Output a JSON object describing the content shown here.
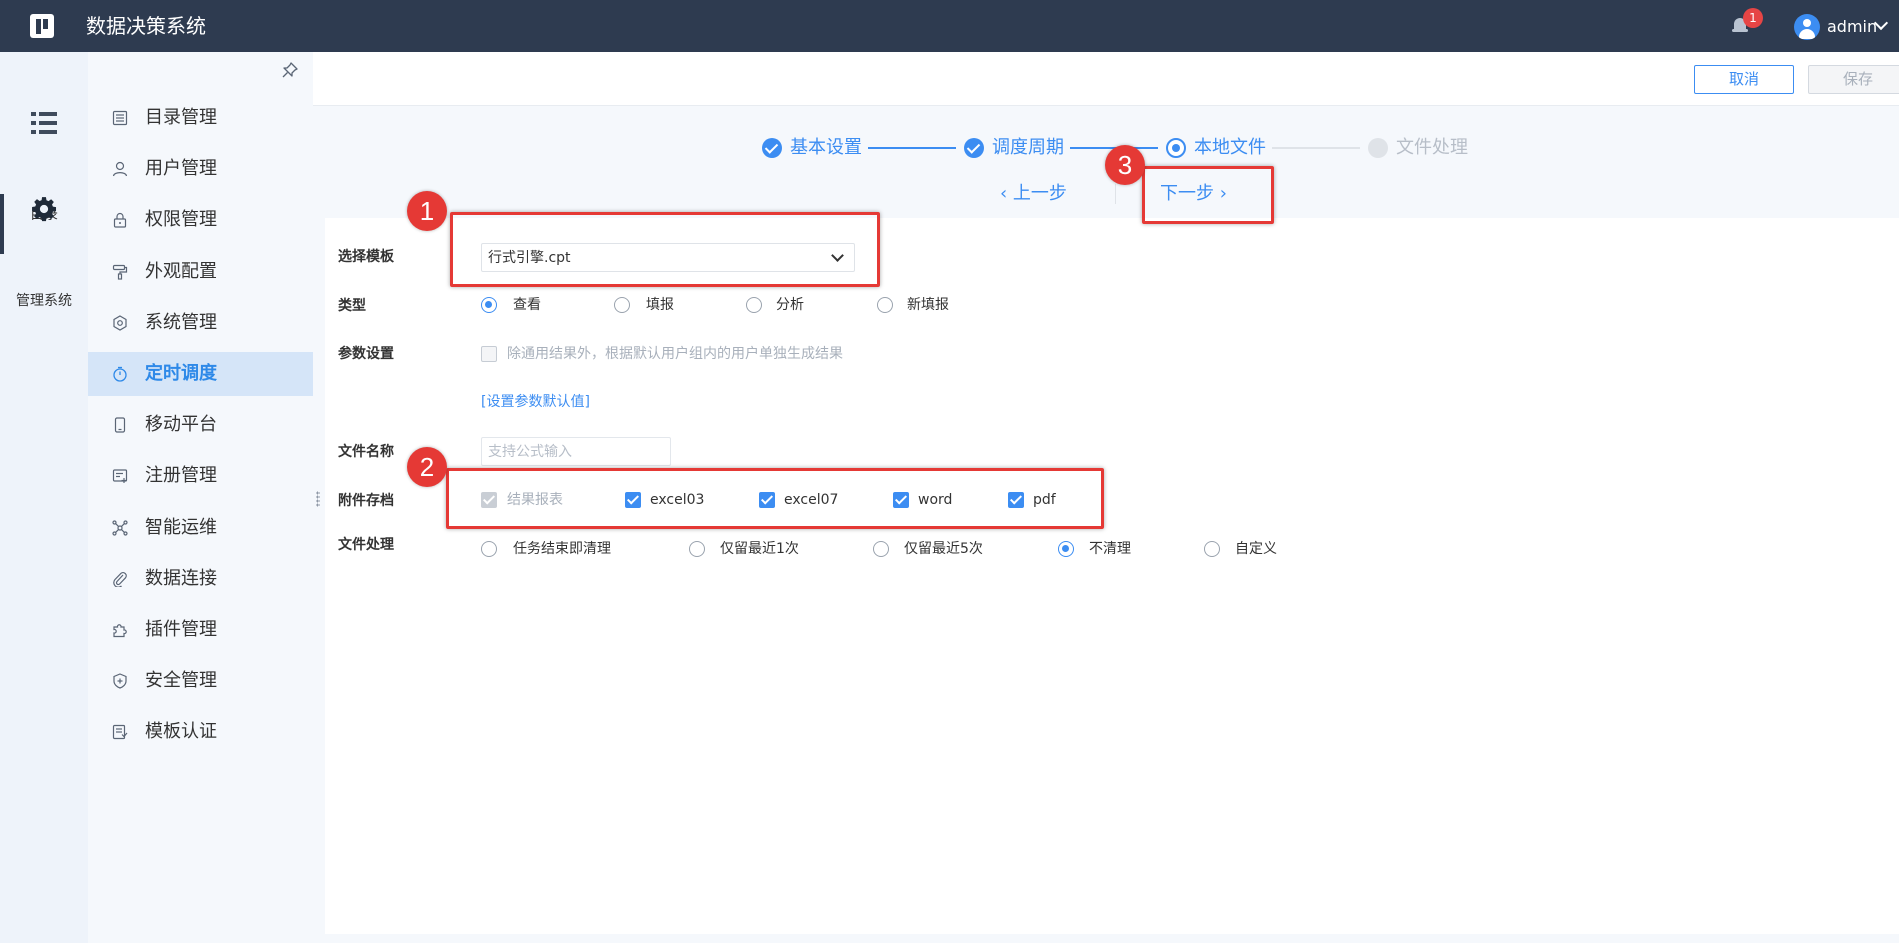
{
  "header": {
    "app_title": "数据决策系统",
    "notification_count": "1",
    "user_name": "admin"
  },
  "rail": {
    "items": [
      {
        "label": "目录",
        "icon": "list-icon"
      },
      {
        "label": "管理系统",
        "icon": "gear-icon",
        "active": true
      }
    ]
  },
  "menu": {
    "items": [
      {
        "label": "目录管理",
        "icon": "directory-icon"
      },
      {
        "label": "用户管理",
        "icon": "user-icon"
      },
      {
        "label": "权限管理",
        "icon": "lock-icon"
      },
      {
        "label": "外观配置",
        "icon": "paint-roller-icon"
      },
      {
        "label": "系统管理",
        "icon": "settings-icon"
      },
      {
        "label": "定时调度",
        "icon": "timer-icon",
        "active": true
      },
      {
        "label": "移动平台",
        "icon": "mobile-icon"
      },
      {
        "label": "注册管理",
        "icon": "register-icon"
      },
      {
        "label": "智能运维",
        "icon": "network-icon"
      },
      {
        "label": "数据连接",
        "icon": "paperclip-icon"
      },
      {
        "label": "插件管理",
        "icon": "puzzle-icon"
      },
      {
        "label": "安全管理",
        "icon": "shield-icon"
      },
      {
        "label": "模板认证",
        "icon": "certificate-icon"
      }
    ]
  },
  "toolbar": {
    "cancel_label": "取消",
    "save_label": "保存"
  },
  "wizard": {
    "steps": [
      {
        "label": "基本设置",
        "state": "done"
      },
      {
        "label": "调度周期",
        "state": "done"
      },
      {
        "label": "本地文件",
        "state": "current"
      },
      {
        "label": "文件处理",
        "state": "todo"
      }
    ],
    "prev_label": "上一步",
    "next_label": "下一步"
  },
  "form": {
    "template_label": "选择模板",
    "template_value": "行式引擎.cpt",
    "type_label": "类型",
    "type_options": [
      {
        "label": "查看",
        "selected": true
      },
      {
        "label": "填报",
        "selected": false
      },
      {
        "label": "分析",
        "selected": false
      },
      {
        "label": "新填报",
        "selected": false
      }
    ],
    "param_label": "参数设置",
    "param_checkbox_label": "除通用结果外，根据默认用户组内的用户单独生成结果",
    "param_link": "[设置参数默认值]",
    "filename_label": "文件名称",
    "filename_placeholder": "支持公式输入",
    "attachment_label": "附件存档",
    "attachment_options": [
      {
        "label": "结果报表",
        "checked": true,
        "disabled": true
      },
      {
        "label": "excel03",
        "checked": true
      },
      {
        "label": "excel07",
        "checked": true
      },
      {
        "label": "word",
        "checked": true
      },
      {
        "label": "pdf",
        "checked": true
      }
    ],
    "fileproc_label": "文件处理",
    "fileproc_options": [
      {
        "label": "任务结束即清理",
        "selected": false
      },
      {
        "label": "仅留最近1次",
        "selected": false
      },
      {
        "label": "仅留最近5次",
        "selected": false
      },
      {
        "label": "不清理",
        "selected": true
      },
      {
        "label": "自定义",
        "selected": false
      }
    ]
  },
  "annotations": {
    "callouts": [
      "1",
      "2",
      "3"
    ]
  },
  "colors": {
    "header_bg": "#2e3b50",
    "accent": "#3c8df2",
    "highlight": "#e53935"
  }
}
